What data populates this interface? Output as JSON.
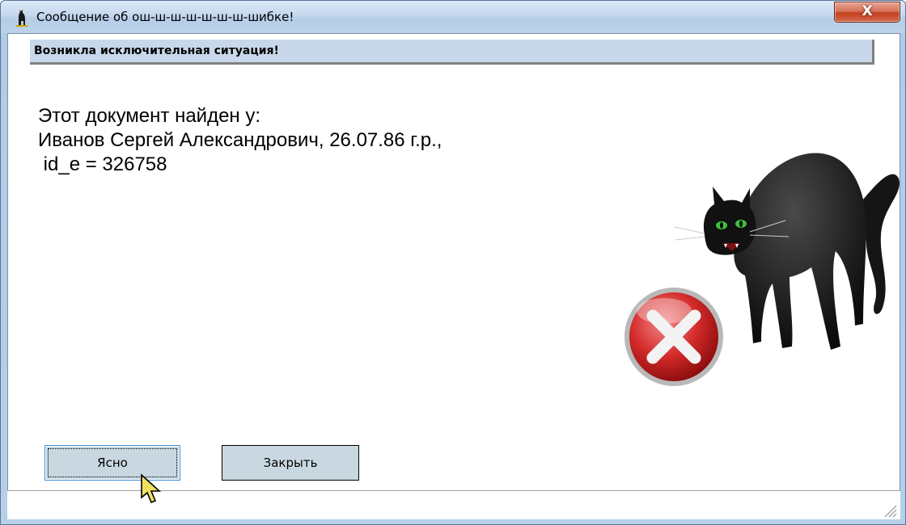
{
  "window": {
    "title": "Сообщение об ош-ш-ш-ш-ш-ш-ш-шибке!",
    "close_label": "X"
  },
  "banner": {
    "text": "Возникла исключительная ситуация!"
  },
  "message": {
    "line1": "Этот документ найден у:",
    "line2": "Иванов Сергей Александрович, 26.07.86 г.р.,",
    "line3": " id_e = 326758"
  },
  "buttons": {
    "ok_label": "Ясно",
    "close_label": "Закрыть"
  },
  "colors": {
    "banner_bg": "#c8d8ea",
    "button_bg": "#c9d8e0",
    "close_btn": "#c1401f",
    "error_red": "#d42a2a"
  },
  "icons": {
    "app": "black-cat-icon",
    "illustration": "arched-cat-with-error-icon",
    "resize": "resize-grip-icon",
    "pointer": "mouse-cursor-icon"
  }
}
